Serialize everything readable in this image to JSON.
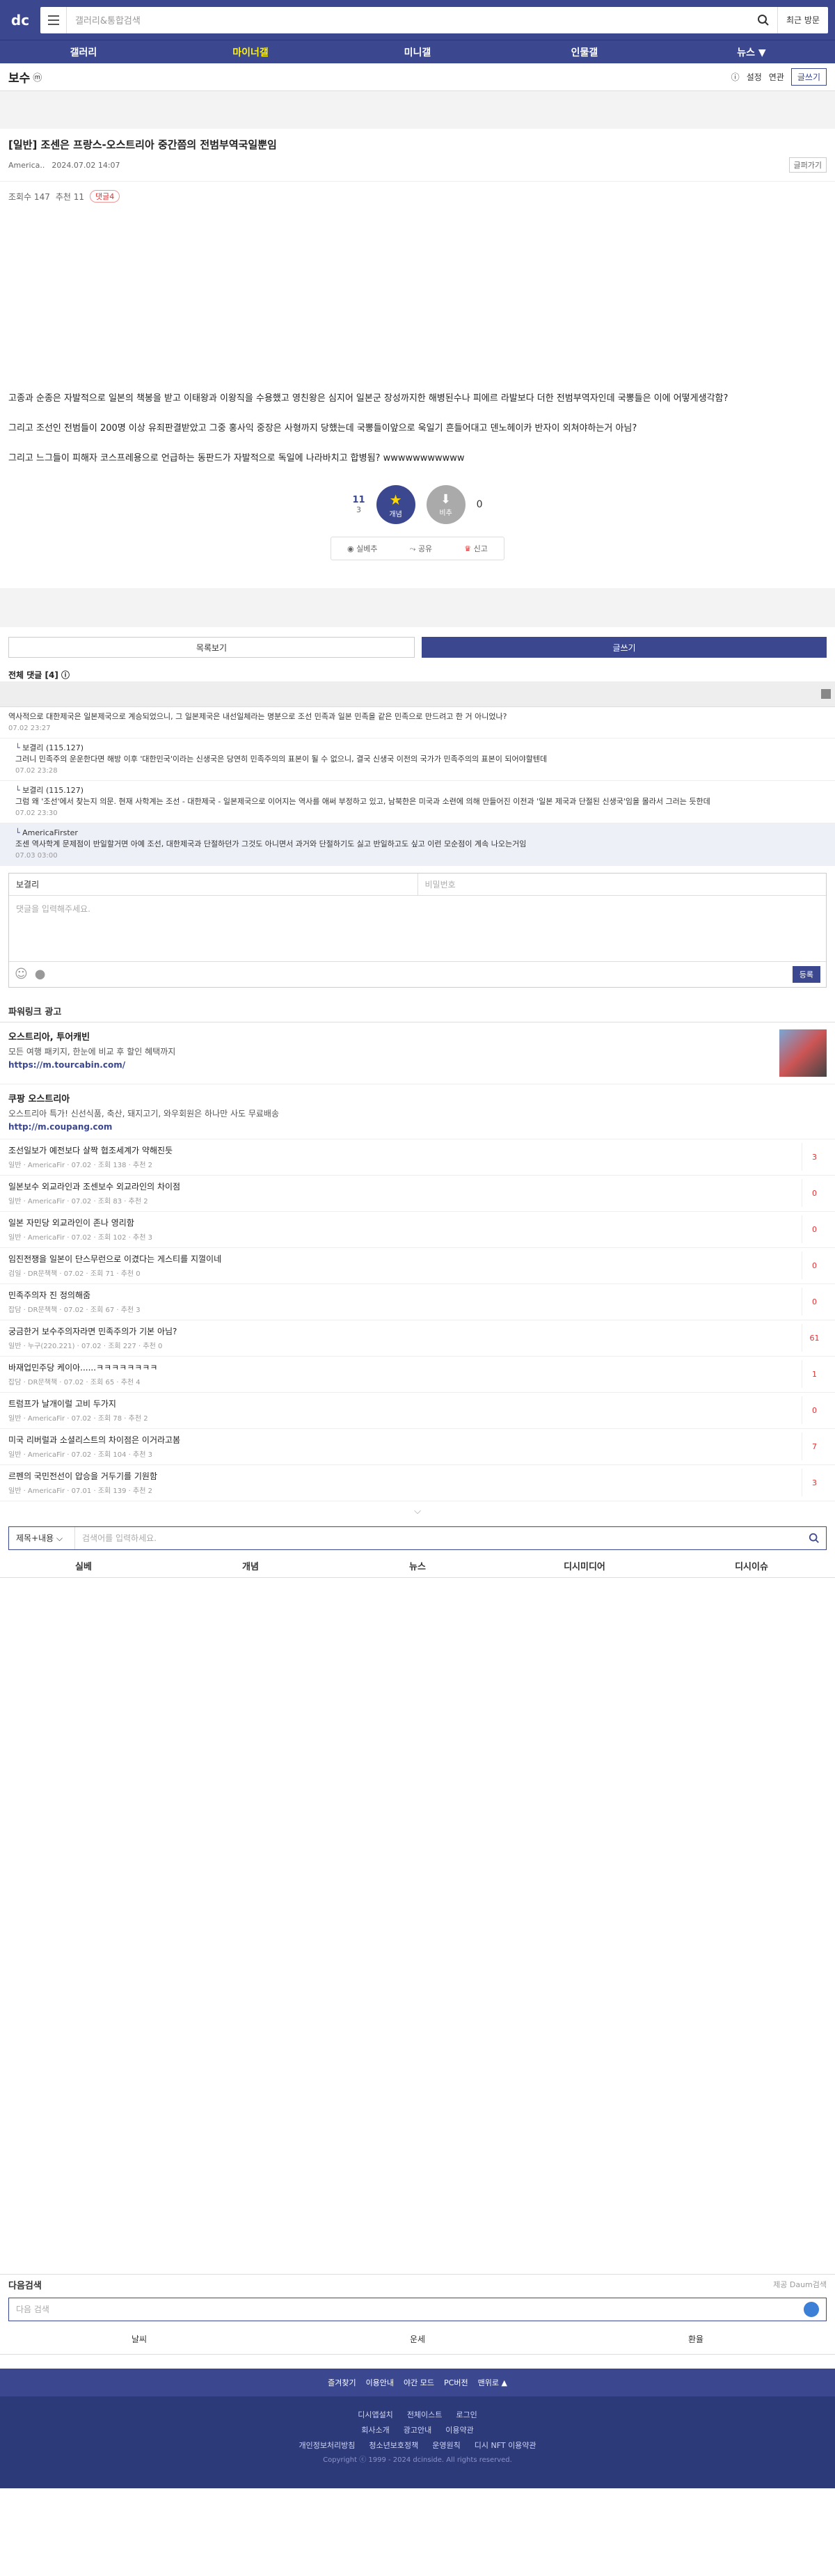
{
  "header": {
    "logo": "dc",
    "search_placeholder": "갤러리&통합검색",
    "recent_label": "최근 방문"
  },
  "gnb": [
    "갤러리",
    "마이너갤",
    "미니갤",
    "인물갤",
    "뉴스 ▼"
  ],
  "gallery": {
    "name": "보수",
    "notice_icon": "ⓜ",
    "settings": "설정",
    "related": "연관",
    "write": "글쓰기"
  },
  "post": {
    "title": "[일반] 조센은 프랑스-오스트리아 중간쯤의 전범부역국일뿐임",
    "author": "America..",
    "date": "2024.07.02 14:07",
    "copy_label": "글퍼가기",
    "views_label": "조회수 147",
    "recommend_label": "추천 11",
    "comment_label": "댓글4",
    "body": [
      "고종과 순종은 자발적으로 일본의 책봉을 받고 이태왕과 이왕직을 수용했고 영친왕은 심지어 일본군 장성까지한 해병된수나 피에르 라발보다 더한 전범부역자인데 국뽕들은 이에 어떻게생각함?",
      "그리고 조선인 전범들이 200명 이상 유죄판결받았고 그중 홍사익 중장은 사형까지 당했는데 국뽕들이앞으로 욱일기 흔들어대고 덴노헤이카 반자이 외쳐야하는거 아님?",
      "그리고 느그들이 피해자 코스프레용으로 언급하는 동판드가 자발적으로 독일에 나라바치고 합병됨? wwwwwwwwwww"
    ],
    "up_count": "11",
    "fix_count": "3",
    "down_count": "0",
    "up_label": "개념",
    "down_label": "비추",
    "actions": [
      "실베추",
      "공유",
      "신고"
    ]
  },
  "list_btn": "목록보기",
  "write_btn": "글쓰기",
  "comments_header": "전체 댓글 [4] ⓘ",
  "comments": [
    {
      "nick": "",
      "text": "역사적으로 대한제국은 일본제국으로 계승되었으니, 그 일본제국은 내선일체라는 명분으로 조선 민족과 일본 민족을 같은 민족으로 만드려고 한 거 아니었나?",
      "date": "07.02 23:27",
      "reply": false,
      "hl": false
    },
    {
      "nick": "보결리 (115.127)",
      "text": "그러니 민족주의 운운한다면 해방 이후 '대한민국'이라는 신생국은 당연히 민족주의의 표본이 될 수 없으니, 결국 신생국 이전의 국가가 민족주의의 표본이 되어야할텐데",
      "date": "07.02 23:28",
      "reply": true,
      "hl": false
    },
    {
      "nick": "보결리 (115.127)",
      "text": "그럼 왜 '조선'에서 찾는지 의문. 현재 사학계는 조선 - 대한제국 - 일본제국으로 이어지는 역사를 애써 부정하고 있고, 남북한은 미국과 소련에 의해 만들어진 이전과 '일본 제국과 단절된 신생국'임을 몰라서 그러는 듯한데",
      "date": "07.02 23:30",
      "reply": true,
      "hl": false
    },
    {
      "nick": "AmericaFirster",
      "text": "조센 역사학계 문제점이 반일할거면 아예 조선, 대한제국과 단절하던가 그것도 아니면서 과거와 단절하기도 싫고 반일하고도 싶고 이런 모순점이 계속 나오는거임",
      "date": "07.03 03:00",
      "reply": true,
      "hl": true
    }
  ],
  "comment_form": {
    "nick": "보결리",
    "pw_placeholder": "비밀번호",
    "text_placeholder": "댓글을 입력해주세요.",
    "submit": "등록"
  },
  "ads": {
    "header": "파워링크 광고",
    "items": [
      {
        "title": "오스트리아, 투어캐빈",
        "desc": "모든 여행 패키지, 한눈에 비교 후 할인 혜택까지",
        "url": "https://m.tourcabin.com/"
      },
      {
        "title": "쿠팡 오스트리아",
        "desc": "오스트리아 특가! 신선식품, 축산, 돼지고기, 와우회원은 하나만 사도 무료배송",
        "url": "http://m.coupang.com"
      }
    ]
  },
  "posts": [
    {
      "title": "조선일보가 예전보다 살짝 협조세계가 약해진듯",
      "info": "일반 · AmericaFir · 07.02 · 조회 138 · 추천 2",
      "cnt": "3"
    },
    {
      "title": "일본보수 외교라인과 조센보수 외교라인의 차이점",
      "info": "일반 · AmericaFir · 07.02 · 조회 83 · 추천 2",
      "cnt": "0"
    },
    {
      "title": "일본 자민당 외교라인이 존나 영리함",
      "info": "일반 · AmericaFir · 07.02 · 조회 102 · 추천 3",
      "cnt": "0"
    },
    {
      "title": "임진전쟁을 일본이 단스무런으로 이겼다는 게스티를 지껄이네",
      "info": "검일 · DR문책책 · 07.02 · 조회 71 · 추천 0",
      "cnt": "0"
    },
    {
      "title": "민족주의자 진 정의해줌",
      "info": "잡담 · DR문책책 · 07.02 · 조회 67 · 추천 3",
      "cnt": "0"
    },
    {
      "title": "궁금한거 보수주의자라면 민족주의가 기본 아님?",
      "info": "일반 · 누구(220.221) · 07.02 · 조회 227 · 추천 0",
      "cnt": "61"
    },
    {
      "title": "바재업민주당 케이아......ㅋㅋㅋㅋㅋㅋㅋㅋ",
      "info": "잡담 · DR문책책 · 07.02 · 조회 65 · 추천 4",
      "cnt": "1"
    },
    {
      "title": "트럼프가 날개이럴 고비 두가지",
      "info": "일반 · AmericaFir · 07.02 · 조회 78 · 추천 2",
      "cnt": "0"
    },
    {
      "title": "미국 리버럴과 소셜리스트의 차이점은 이거라고봄",
      "info": "일반 · AmericaFir · 07.02 · 조회 104 · 추천 3",
      "cnt": "7"
    },
    {
      "title": "르펜의 국민전선이 압승을 거두기를 기원함",
      "info": "일반 · AmericaFir · 07.01 · 조회 139 · 추천 2",
      "cnt": "3"
    }
  ],
  "bottom_search": {
    "select": "제목+내용 ⌵",
    "placeholder": "검색어를 입력하세요."
  },
  "bottom_tabs": [
    "실베",
    "개념",
    "뉴스",
    "디시미디어",
    "디시이슈"
  ],
  "daum": {
    "title": "다음검색",
    "badge": "제공 Daum검색",
    "placeholder": "다음 검색",
    "tabs": [
      "날씨",
      "운세",
      "환율"
    ]
  },
  "foot_links": [
    "즐겨찾기",
    "이용안내",
    "야간 모드",
    "PC버전",
    "맨위로 ▲"
  ],
  "footer": {
    "row1": [
      "디시앱설치",
      "전체이스트",
      "로그인"
    ],
    "row2": [
      "회사소개",
      "광고안내",
      "이용약관"
    ],
    "row3": [
      "개인정보처리방침",
      "청소년보호정책",
      "운영원칙",
      "디시 NFT 이용약관"
    ],
    "copy": "Copyright ⓒ 1999 - 2024 dcinside. All rights reserved."
  }
}
